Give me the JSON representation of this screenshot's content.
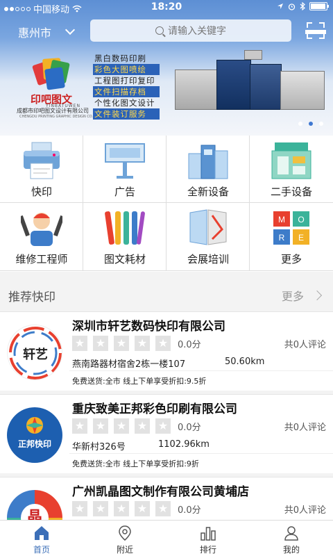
{
  "statusbar": {
    "carrier": "中国移动",
    "time": "18:20"
  },
  "topbar": {
    "city": "惠州市",
    "search_placeholder": "请输入关键字"
  },
  "banner": {
    "logo_name": "印吧图文",
    "logo_en": "YINBATUWEN",
    "company_cn": "成都市印吧图文设计有限公司",
    "company_en": "CHENGDU PRINTING GRAPHIC DESIGN CO.,LTD",
    "slogans": [
      {
        "text": "黑白数码印刷",
        "bg": "",
        "fg": "#222222"
      },
      {
        "text": "彩色大图喷绘",
        "bg": "#2b62b8",
        "fg": "#ffd84a"
      },
      {
        "text": "工程图打印复印",
        "bg": "",
        "fg": "#222222"
      },
      {
        "text": "文件扫描存档",
        "bg": "#2b62b8",
        "fg": "#ffd84a"
      },
      {
        "text": "个性化图文设计",
        "bg": "",
        "fg": "#222222"
      },
      {
        "text": "文件装订服务",
        "bg": "#2b62b8",
        "fg": "#ffd84a"
      }
    ],
    "active_slide": 2,
    "slide_count": 3
  },
  "categories": [
    {
      "label": "快印",
      "icon": "printer-icon"
    },
    {
      "label": "广告",
      "icon": "billboard-icon"
    },
    {
      "label": "全新设备",
      "icon": "new-equipment-icon"
    },
    {
      "label": "二手设备",
      "icon": "used-equipment-icon"
    },
    {
      "label": "维修工程师",
      "icon": "repair-engineer-icon"
    },
    {
      "label": "图文耗材",
      "icon": "consumables-icon"
    },
    {
      "label": "会展培训",
      "icon": "exhibition-training-icon"
    },
    {
      "label": "更多",
      "icon": "more-icon"
    }
  ],
  "recommend": {
    "title": "推荐快印",
    "more": "更多",
    "shops": [
      {
        "name": "深圳市轩艺数码快印有限公司",
        "score": "0.0分",
        "reviews": "共0人评论",
        "address": "燕南路器材宿舍2栋一楼107",
        "distance": "50.60km",
        "promo": "免费送货:全市  线上下单享受折扣:9.5折",
        "logo_text": "轩艺"
      },
      {
        "name": "重庆致美正邦彩色印刷有限公司",
        "score": "0.0分",
        "reviews": "共0人评论",
        "address": "华新村326号",
        "distance": "1102.96km",
        "promo": "免费送货:全市  线上下单享受折扣:9折",
        "logo_text": "正邦快印"
      },
      {
        "name": "广州凯晶图文制作有限公司黄埔店",
        "score": "0.0分",
        "reviews": "共0人评论",
        "address": "",
        "distance": "",
        "promo": "",
        "logo_text": "晶"
      }
    ]
  },
  "tabs": [
    {
      "label": "首页",
      "icon": "home-icon"
    },
    {
      "label": "附近",
      "icon": "location-icon"
    },
    {
      "label": "排行",
      "icon": "ranking-icon"
    },
    {
      "label": "我的",
      "icon": "profile-icon"
    }
  ],
  "colors": {
    "accent": "#3c6fb8",
    "star_empty": "#e2e2e2"
  }
}
